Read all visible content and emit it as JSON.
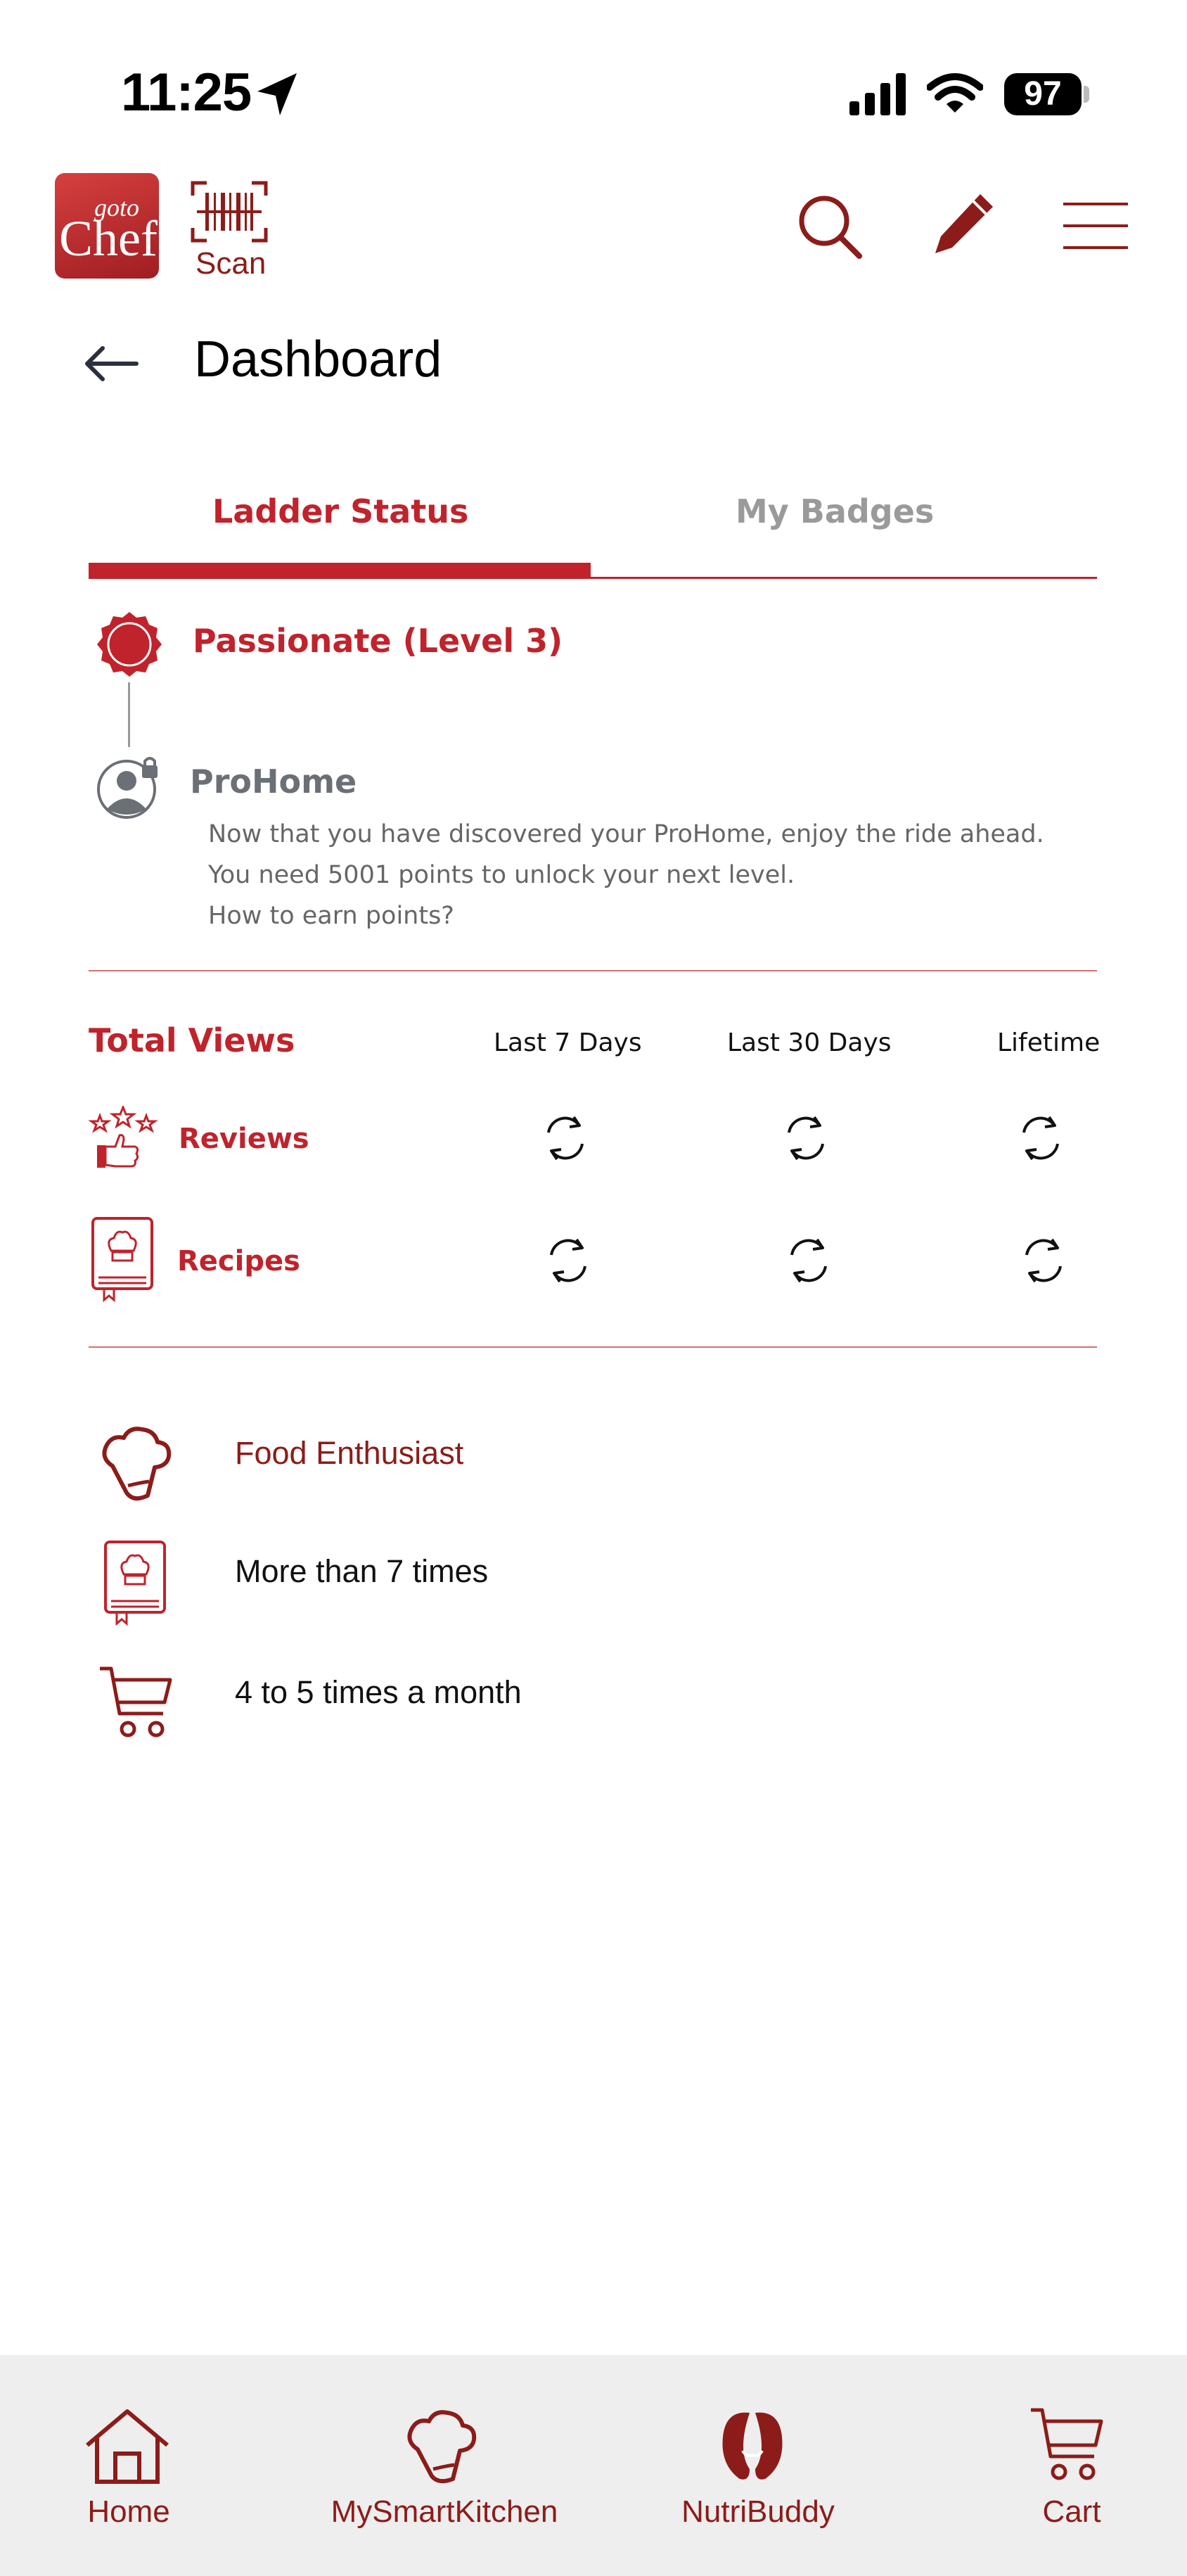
{
  "status_bar": {
    "time": "11:25",
    "battery": "97"
  },
  "header": {
    "logo_top": "goto",
    "logo_bottom": "Chef",
    "scan_label": "Scan"
  },
  "page": {
    "title": "Dashboard"
  },
  "tabs": [
    {
      "label": "Ladder Status",
      "active": true
    },
    {
      "label": "My Badges",
      "active": false
    }
  ],
  "ladder": {
    "current_level": "Passionate (Level 3)",
    "next_level": "ProHome",
    "description_lines": [
      "Now that you have discovered your ProHome, enjoy the ride ahead.",
      "You need 5001 points to unlock your next level.",
      "How to earn points?"
    ]
  },
  "stats": {
    "title": "Total Views",
    "columns": [
      "Last 7 Days",
      "Last 30 Days",
      "Lifetime"
    ],
    "rows": [
      {
        "label": "Reviews"
      },
      {
        "label": "Recipes"
      }
    ]
  },
  "profile": {
    "items": [
      {
        "text": "Food Enthusiast"
      },
      {
        "text": "More than 7 times"
      },
      {
        "text": "4 to 5 times a month"
      }
    ]
  },
  "bottom_nav": {
    "items": [
      {
        "label": "Home"
      },
      {
        "label": "MySmartKitchen"
      },
      {
        "label": "NutriBuddy"
      },
      {
        "label": "Cart"
      }
    ]
  },
  "colors": {
    "brand_red": "#c0232b",
    "dark_red": "#8c1c19",
    "nav_bg": "#eeeeee"
  }
}
